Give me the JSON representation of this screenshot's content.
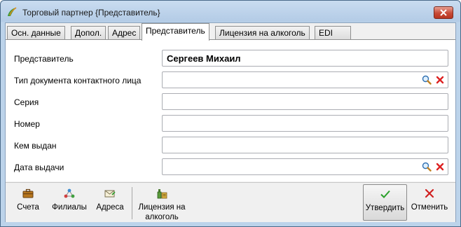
{
  "window": {
    "title": "Торговый партнер {Представитель}"
  },
  "tabs": [
    {
      "label": "Осн. данные",
      "active": false
    },
    {
      "label": "Допол.",
      "active": false
    },
    {
      "label": "Адрес",
      "active": false
    },
    {
      "label": "Представитель",
      "active": true
    },
    {
      "label": "Лицензия на алкоголь",
      "active": false
    },
    {
      "label": "EDI",
      "active": false
    }
  ],
  "form": {
    "rows": [
      {
        "label": "Представитель",
        "value": "Сергеев Михаил"
      },
      {
        "label": "Тип документа контактного лица",
        "value": ""
      },
      {
        "label": "Серия",
        "value": ""
      },
      {
        "label": "Номер",
        "value": ""
      },
      {
        "label": "Кем выдан",
        "value": ""
      },
      {
        "label": "Дата выдачи",
        "value": ""
      }
    ]
  },
  "toolbar": {
    "accounts": "Счета",
    "branches": "Филиалы",
    "addresses": "Адреса",
    "license_line1": "Лицензия на",
    "license_line2": "алкоголь",
    "confirm": "Утвердить",
    "cancel": "Отменить"
  }
}
